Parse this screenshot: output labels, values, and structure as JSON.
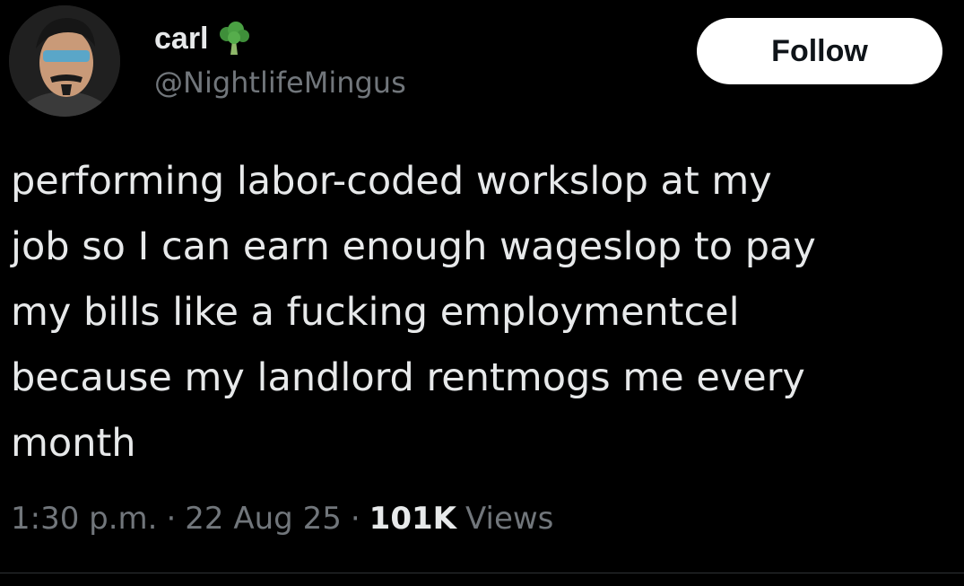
{
  "user": {
    "display_name": "carl",
    "handle": "@NightlifeMingus",
    "badge_icon": "broccoli-icon",
    "avatar_icon": "avatar-icon"
  },
  "actions": {
    "follow_label": "Follow"
  },
  "tweet": {
    "text": "performing labor-coded workslop at my\njob so I can earn enough wageslop to pay\nmy bills like a fucking employmentcel\nbecause my landlord rentmogs me every\nmonth"
  },
  "meta": {
    "time": "1:30 p.m.",
    "separator": "·",
    "date": "22 Aug 25",
    "views_count": "101K",
    "views_label": "Views"
  },
  "colors": {
    "background": "#000000",
    "primary_text": "#e7e9ea",
    "secondary_text": "#71767b",
    "follow_bg": "#ffffff",
    "follow_text": "#0f1419"
  }
}
